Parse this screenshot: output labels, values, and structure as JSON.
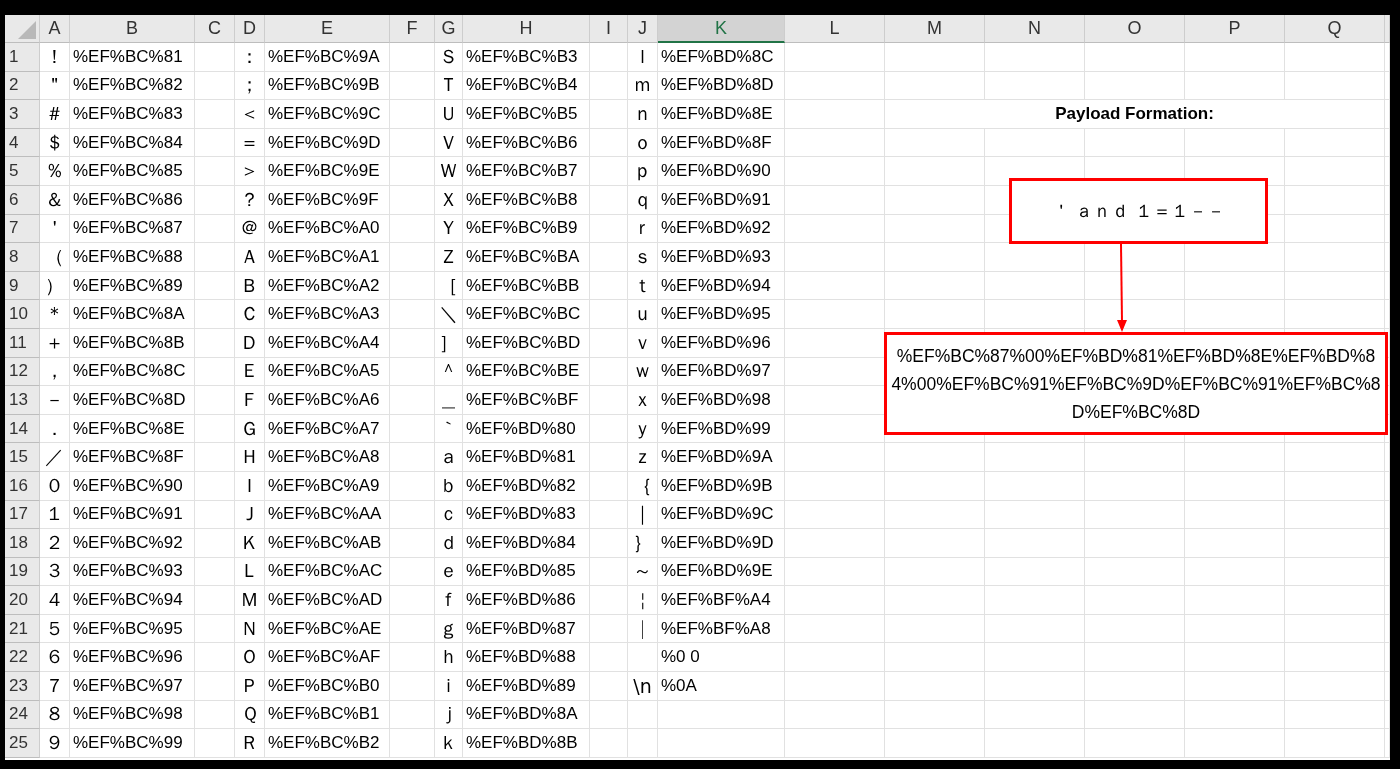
{
  "sheet": {
    "columns": [
      {
        "label": "A",
        "selected": false
      },
      {
        "label": "B",
        "selected": false
      },
      {
        "label": "C",
        "selected": false
      },
      {
        "label": "D",
        "selected": false
      },
      {
        "label": "E",
        "selected": false
      },
      {
        "label": "F",
        "selected": false
      },
      {
        "label": "G",
        "selected": false
      },
      {
        "label": "H",
        "selected": false
      },
      {
        "label": "I",
        "selected": false
      },
      {
        "label": "J",
        "selected": false
      },
      {
        "label": "K",
        "selected": true
      },
      {
        "label": "L",
        "selected": false
      },
      {
        "label": "M",
        "selected": false
      },
      {
        "label": "N",
        "selected": false
      },
      {
        "label": "O",
        "selected": false
      },
      {
        "label": "P",
        "selected": false
      },
      {
        "label": "Q",
        "selected": false
      }
    ],
    "rows": [
      {
        "number": "1",
        "pairs": [
          {
            "char": "！",
            "code": "%EF%BC%81"
          },
          {
            "char": "：",
            "code": "%EF%BC%9A"
          },
          {
            "char": "Ｓ",
            "code": "%EF%BC%B3"
          },
          {
            "char": "ｌ",
            "code": "%EF%BD%8C"
          }
        ]
      },
      {
        "number": "2",
        "pairs": [
          {
            "char": "＂",
            "code": "%EF%BC%82"
          },
          {
            "char": "；",
            "code": "%EF%BC%9B"
          },
          {
            "char": "Ｔ",
            "code": "%EF%BC%B4"
          },
          {
            "char": "ｍ",
            "code": "%EF%BD%8D"
          }
        ]
      },
      {
        "number": "3",
        "pairs": [
          {
            "char": "＃",
            "code": "%EF%BC%83"
          },
          {
            "char": "＜",
            "code": "%EF%BC%9C"
          },
          {
            "char": "Ｕ",
            "code": "%EF%BC%B5"
          },
          {
            "char": "ｎ",
            "code": "%EF%BD%8E"
          }
        ]
      },
      {
        "number": "4",
        "pairs": [
          {
            "char": "＄",
            "code": "%EF%BC%84"
          },
          {
            "char": "＝",
            "code": "%EF%BC%9D"
          },
          {
            "char": "Ｖ",
            "code": "%EF%BC%B6"
          },
          {
            "char": "ｏ",
            "code": "%EF%BD%8F"
          }
        ]
      },
      {
        "number": "5",
        "pairs": [
          {
            "char": "％",
            "code": "%EF%BC%85"
          },
          {
            "char": "＞",
            "code": "%EF%BC%9E"
          },
          {
            "char": "Ｗ",
            "code": "%EF%BC%B7"
          },
          {
            "char": "ｐ",
            "code": "%EF%BD%90"
          }
        ]
      },
      {
        "number": "6",
        "pairs": [
          {
            "char": "＆",
            "code": "%EF%BC%86"
          },
          {
            "char": "？",
            "code": "%EF%BC%9F"
          },
          {
            "char": "Ｘ",
            "code": "%EF%BC%B8"
          },
          {
            "char": "ｑ",
            "code": "%EF%BD%91"
          }
        ]
      },
      {
        "number": "7",
        "pairs": [
          {
            "char": "＇",
            "code": "%EF%BC%87"
          },
          {
            "char": "＠",
            "code": "%EF%BC%A0"
          },
          {
            "char": "Ｙ",
            "code": "%EF%BC%B9"
          },
          {
            "char": "ｒ",
            "code": "%EF%BD%92"
          }
        ]
      },
      {
        "number": "8",
        "pairs": [
          {
            "char": "（",
            "code": "%EF%BC%88"
          },
          {
            "char": "Ａ",
            "code": "%EF%BC%A1"
          },
          {
            "char": "Ｚ",
            "code": "%EF%BC%BA"
          },
          {
            "char": "ｓ",
            "code": "%EF%BD%93"
          }
        ]
      },
      {
        "number": "9",
        "pairs": [
          {
            "char": "）",
            "code": "%EF%BC%89"
          },
          {
            "char": "Ｂ",
            "code": "%EF%BC%A2"
          },
          {
            "char": "［",
            "code": "%EF%BC%BB"
          },
          {
            "char": "ｔ",
            "code": "%EF%BD%94"
          }
        ]
      },
      {
        "number": "10",
        "pairs": [
          {
            "char": "＊",
            "code": "%EF%BC%8A"
          },
          {
            "char": "Ｃ",
            "code": "%EF%BC%A3"
          },
          {
            "char": "＼",
            "code": "%EF%BC%BC"
          },
          {
            "char": "ｕ",
            "code": "%EF%BD%95"
          }
        ]
      },
      {
        "number": "11",
        "pairs": [
          {
            "char": "＋",
            "code": "%EF%BC%8B"
          },
          {
            "char": "Ｄ",
            "code": "%EF%BC%A4"
          },
          {
            "char": "］",
            "code": "%EF%BC%BD"
          },
          {
            "char": "ｖ",
            "code": "%EF%BD%96"
          }
        ]
      },
      {
        "number": "12",
        "pairs": [
          {
            "char": "，",
            "code": "%EF%BC%8C"
          },
          {
            "char": "Ｅ",
            "code": "%EF%BC%A5"
          },
          {
            "char": "＾",
            "code": "%EF%BC%BE"
          },
          {
            "char": "ｗ",
            "code": "%EF%BD%97"
          }
        ]
      },
      {
        "number": "13",
        "pairs": [
          {
            "char": "－",
            "code": "%EF%BC%8D"
          },
          {
            "char": "Ｆ",
            "code": "%EF%BC%A6"
          },
          {
            "char": "＿",
            "code": "%EF%BC%BF"
          },
          {
            "char": "ｘ",
            "code": "%EF%BD%98"
          }
        ]
      },
      {
        "number": "14",
        "pairs": [
          {
            "char": "．",
            "code": "%EF%BC%8E"
          },
          {
            "char": "Ｇ",
            "code": "%EF%BC%A7"
          },
          {
            "char": "｀",
            "code": "%EF%BD%80"
          },
          {
            "char": "ｙ",
            "code": "%EF%BD%99"
          }
        ]
      },
      {
        "number": "15",
        "pairs": [
          {
            "char": "／",
            "code": "%EF%BC%8F"
          },
          {
            "char": "Ｈ",
            "code": "%EF%BC%A8"
          },
          {
            "char": "ａ",
            "code": "%EF%BD%81"
          },
          {
            "char": "ｚ",
            "code": "%EF%BD%9A"
          }
        ]
      },
      {
        "number": "16",
        "pairs": [
          {
            "char": "０",
            "code": "%EF%BC%90"
          },
          {
            "char": "Ｉ",
            "code": "%EF%BC%A9"
          },
          {
            "char": "ｂ",
            "code": "%EF%BD%82"
          },
          {
            "char": "｛",
            "code": "%EF%BD%9B"
          }
        ]
      },
      {
        "number": "17",
        "pairs": [
          {
            "char": "１",
            "code": "%EF%BC%91"
          },
          {
            "char": "Ｊ",
            "code": "%EF%BC%AA"
          },
          {
            "char": "ｃ",
            "code": "%EF%BD%83"
          },
          {
            "char": "｜",
            "code": "%EF%BD%9C"
          }
        ]
      },
      {
        "number": "18",
        "pairs": [
          {
            "char": "２",
            "code": "%EF%BC%92"
          },
          {
            "char": "Ｋ",
            "code": "%EF%BC%AB"
          },
          {
            "char": "ｄ",
            "code": "%EF%BD%84"
          },
          {
            "char": "｝",
            "code": "%EF%BD%9D"
          }
        ]
      },
      {
        "number": "19",
        "pairs": [
          {
            "char": "３",
            "code": "%EF%BC%93"
          },
          {
            "char": "Ｌ",
            "code": "%EF%BC%AC"
          },
          {
            "char": "ｅ",
            "code": "%EF%BD%85"
          },
          {
            "char": "～",
            "code": "%EF%BD%9E"
          }
        ]
      },
      {
        "number": "20",
        "pairs": [
          {
            "char": "４",
            "code": "%EF%BC%94"
          },
          {
            "char": "Ｍ",
            "code": "%EF%BC%AD"
          },
          {
            "char": "ｆ",
            "code": "%EF%BD%86"
          },
          {
            "char": "￤",
            "code": "%EF%BF%A4"
          }
        ]
      },
      {
        "number": "21",
        "pairs": [
          {
            "char": "５",
            "code": "%EF%BC%95"
          },
          {
            "char": "Ｎ",
            "code": "%EF%BC%AE"
          },
          {
            "char": "ｇ",
            "code": "%EF%BD%87"
          },
          {
            "char": "￨",
            "code": "%EF%BF%A8"
          }
        ]
      },
      {
        "number": "22",
        "pairs": [
          {
            "char": "６",
            "code": "%EF%BC%96"
          },
          {
            "char": "Ｏ",
            "code": "%EF%BC%AF"
          },
          {
            "char": "ｈ",
            "code": "%EF%BD%88"
          },
          {
            "code": "%0 0"
          }
        ]
      },
      {
        "number": "23",
        "pairs": [
          {
            "char": "７",
            "code": "%EF%BC%97"
          },
          {
            "char": "Ｐ",
            "code": "%EF%BC%B0"
          },
          {
            "char": "ｉ",
            "code": "%EF%BD%89"
          },
          {
            "char": "\\n",
            "code": "%0A"
          }
        ]
      },
      {
        "number": "24",
        "pairs": [
          {
            "char": "８",
            "code": "%EF%BC%98"
          },
          {
            "char": "Ｑ",
            "code": "%EF%BC%B1"
          },
          {
            "char": "ｊ",
            "code": "%EF%BD%8A"
          }
        ]
      },
      {
        "number": "25",
        "pairs": [
          {
            "char": "９",
            "code": "%EF%BC%99"
          },
          {
            "char": "Ｒ",
            "code": "%EF%BC%B2"
          },
          {
            "char": "ｋ",
            "code": "%EF%BD%8B"
          }
        ]
      }
    ]
  },
  "diagram": {
    "title": "Payload Formation:",
    "input": "＇ ａｎｄ １＝１－－",
    "output": "%EF%BC%87%00%EF%BD%81%EF%BD%8E%EF%BD%84%00%EF%BC%91%EF%BC%9D%EF%BC%91%EF%BC%8D%EF%BC%8D"
  }
}
